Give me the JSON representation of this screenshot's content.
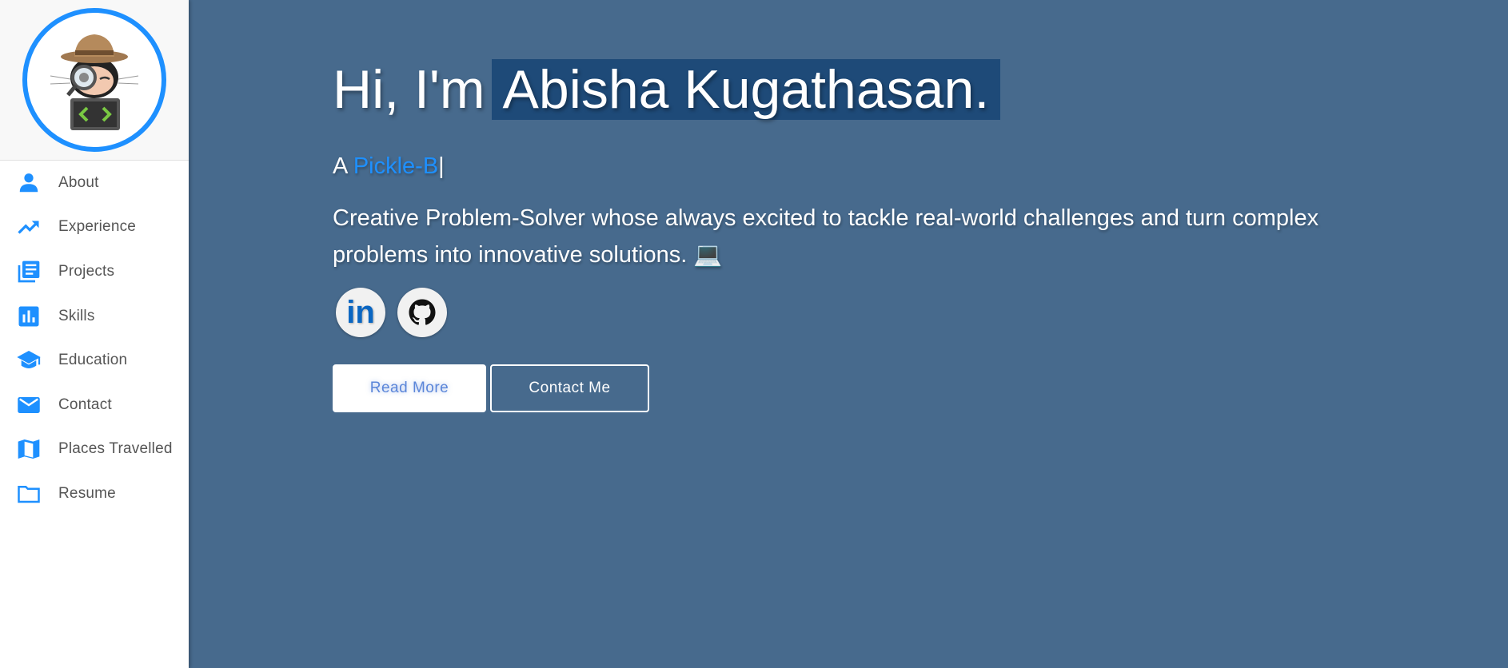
{
  "sidebar": {
    "avatar_alt": "octocat detective",
    "items": [
      {
        "label": "About",
        "icon": "person-icon"
      },
      {
        "label": "Experience",
        "icon": "trending-up-icon"
      },
      {
        "label": "Projects",
        "icon": "library-books-icon"
      },
      {
        "label": "Skills",
        "icon": "bar-chart-icon"
      },
      {
        "label": "Education",
        "icon": "school-icon"
      },
      {
        "label": "Contact",
        "icon": "mail-icon"
      },
      {
        "label": "Places Travelled",
        "icon": "map-icon"
      },
      {
        "label": "Resume",
        "icon": "folder-icon"
      }
    ]
  },
  "hero": {
    "greeting": "Hi, I'm",
    "name": "Abisha Kugathasan.",
    "subtitle_prefix": "A",
    "subtitle_role": "Pickle-B",
    "cursor": "|",
    "description": "Creative Problem-Solver whose always excited to tackle real-world challenges and turn complex problems into innovative solutions.",
    "emoji": "💻"
  },
  "socials": {
    "linkedin_text": "in",
    "icons": [
      "linkedin-icon",
      "github-icon"
    ]
  },
  "buttons": {
    "read_more": "Read More",
    "contact_me": "Contact Me"
  },
  "colors": {
    "background": "#476a8d",
    "accent": "#1e90ff",
    "name_highlight": "#1e4a78"
  }
}
